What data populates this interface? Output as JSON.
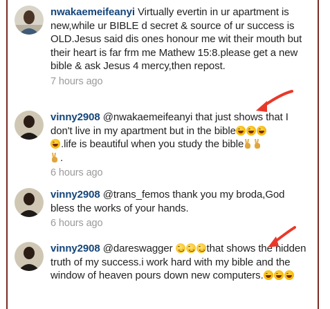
{
  "comments": [
    {
      "username": "nwakaemeifeanyi",
      "text": " Virtually evertin in ur apartment is new,while ur BIBLE d secret & source of ur success is OLD.Jesus said dis ones honour me wit their mouth but their heart is far frm me Mathew 15:8.please get a new bible & ask Jesus 4 mercy,then repost.",
      "time": "7 hours ago"
    },
    {
      "username": "vinny2908",
      "text_a": " @nwakaemeifeanyi that just shows that I don't live in my apartment but in the bible",
      "text_b": ".life is beautiful when you study the bible",
      "text_c": ".",
      "time": "6 hours ago"
    },
    {
      "username": "vinny2908",
      "text": " @trans_femos thank you my broda,God bless the works of your hands.",
      "time": "6 hours ago"
    },
    {
      "username": "vinny2908",
      "text_a": " @dareswagger ",
      "text_b": "that shows the hidden truth of my success.i work hard with my bible and the window of heaven pours down new computers.",
      "time": ""
    }
  ],
  "colors": {
    "username": "#14457a",
    "timestamp": "#9a9a9a",
    "annotation_arrow": "#e8382a",
    "frame_border": "#7a2a22"
  },
  "icons": [
    "grinning-face-emoji",
    "flushed-face-emoji",
    "victory-hand-emoji",
    "red-annotation-arrow"
  ]
}
